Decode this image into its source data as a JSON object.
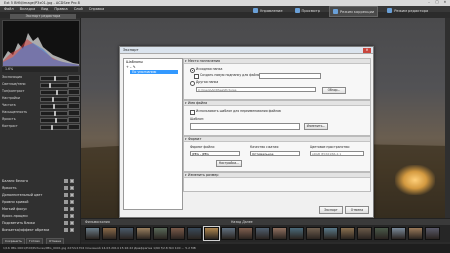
{
  "window": {
    "title": "Ext 5 BHN/image/P3x01.jpg - ACDSee Pro 8",
    "controls": [
      "–",
      "□",
      "✕"
    ]
  },
  "menu": [
    "Файл",
    "Вкладка",
    "Вид",
    "Правка",
    "Слой",
    "Справка"
  ],
  "modes": [
    {
      "label": "Управление",
      "active": false
    },
    {
      "label": "Просмотр",
      "active": false
    },
    {
      "label": "Режим коррекции",
      "active": true
    },
    {
      "label": "Режим редактора",
      "active": false
    }
  ],
  "left_panel": {
    "title": "Экспорт редактора",
    "zoom_value": "1.6%",
    "rows": [
      {
        "label": "Экспозиция"
      },
      {
        "label": "Светлые/тени"
      },
      {
        "label": "Тон/контраст"
      },
      {
        "label": "Настройки"
      },
      {
        "label": "Чистота"
      },
      {
        "label": "Насыщенность"
      },
      {
        "label": "Яркость"
      },
      {
        "label": "Контраст"
      }
    ],
    "sections": [
      "Баланс белого",
      "Яркость",
      "Дополнительный цвет",
      "Уровни кривой",
      "Мягкий фокус",
      "Кросс-процесс",
      "Подсветить блики",
      "Виньетка/эффект обрезки"
    ]
  },
  "dialog": {
    "title": "Экспорт",
    "close": "✕",
    "tree_header": "Шаблоны",
    "tree_item": "По умолчанию",
    "groups": {
      "location": {
        "title": "Место назначения",
        "radio1": "Исходная папка",
        "check1": "Создать новую подпапку для файлов",
        "radio2": "Другая папка",
        "path": "C:\\Users\\ACDSee\\Pictures",
        "browse": "Обзор..."
      },
      "filename": {
        "title": "Имя файла",
        "check": "Использовать шаблон для переименования файлов",
        "template_label": "Шаблон:",
        "template_btn": "Изменить..."
      },
      "format": {
        "title": "Формат",
        "format_label": "Формат файла:",
        "format_value": "JPEG - JPEG",
        "quality_label": "Качество сжатия:",
        "quality_value": "Оптимальное",
        "size_label": "Цветовое пространство:",
        "size_value": "sRGB IEC61966-2.1",
        "settings_btn": "Настройки..."
      },
      "resize": {
        "title": "Изменить размер"
      }
    },
    "export_btn": "Экспорт",
    "cancel_btn": "Отмена"
  },
  "filmstrip": {
    "label": "Фильмоскопия",
    "counter": "Назад  Далее",
    "thumb_count": 21,
    "selected_index": 7
  },
  "bottom_buttons": [
    "Сохранить",
    "Готово",
    "Отмена"
  ],
  "statusbar": "1/16   IMG 0001/Edit/Pictures/IMG_0001.jpg  2272x1704   Основной  14.03.2014 15:16:22  Диафрагма 1/60 f/2.8  ISO 100 ... 5.2 MB"
}
